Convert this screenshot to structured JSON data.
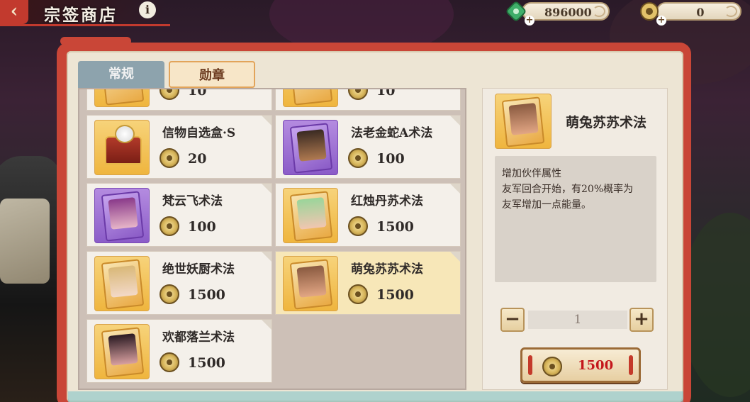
{
  "header": {
    "back_icon": "back-arrow-icon",
    "title": "宗签商店",
    "info_icon": "info-icon",
    "currencies": [
      {
        "icon": "jade-gem-icon",
        "value": "896000"
      },
      {
        "icon": "medal-coin-icon",
        "value": "0"
      }
    ]
  },
  "tabs": [
    {
      "label": "常规",
      "active": false
    },
    {
      "label": "勋章",
      "active": true
    }
  ],
  "items": [
    {
      "name": "",
      "price": "10",
      "icon": "talisman-card-icon",
      "selected": false
    },
    {
      "name": "",
      "price": "10",
      "icon": "talisman-card-icon",
      "selected": false
    },
    {
      "name": "信物自选盒·S",
      "price": "20",
      "icon": "treasure-box-icon",
      "selected": false
    },
    {
      "name": "法老金蛇A术法",
      "price": "100",
      "icon": "purple-spell-card-icon",
      "selected": false
    },
    {
      "name": "梵云飞术法",
      "price": "100",
      "icon": "purple-spell-card-icon",
      "selected": false
    },
    {
      "name": "红烛丹苏术法",
      "price": "1500",
      "icon": "gold-spell-card-icon",
      "selected": false
    },
    {
      "name": "绝世妖厨术法",
      "price": "1500",
      "icon": "gold-spell-card-icon",
      "selected": false
    },
    {
      "name": "萌兔苏苏术法",
      "price": "1500",
      "icon": "gold-spell-card-icon",
      "selected": true
    },
    {
      "name": "欢都落兰术法",
      "price": "1500",
      "icon": "gold-spell-card-icon",
      "selected": false
    }
  ],
  "detail": {
    "name": "萌兔苏苏术法",
    "description_lines": [
      "增加伙伴属性",
      "友军回合开始，有20%概率为",
      "友军增加一点能量。"
    ],
    "quantity": "1",
    "minus_label": "−",
    "plus_label": "+",
    "buy_price": "1500"
  },
  "colors": {
    "frame_red": "#c94637",
    "panel_bg": "#ede5d4",
    "selected_item": "#f7e7b8",
    "price_red": "#c4171c"
  }
}
